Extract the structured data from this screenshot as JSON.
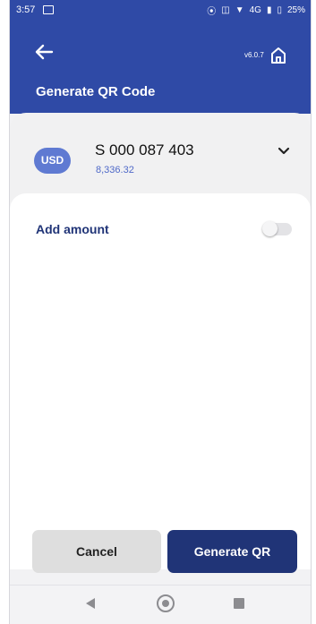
{
  "status_bar": {
    "time": "3:57",
    "network": "4G",
    "battery": "25%"
  },
  "app_bar": {
    "version": "v6.0.7",
    "title": "Generate QR Code"
  },
  "account": {
    "currency": "USD",
    "number": "S 000 087 403",
    "balance": "8,336.32"
  },
  "form": {
    "add_amount_label": "Add amount",
    "add_amount_enabled": false
  },
  "actions": {
    "cancel_label": "Cancel",
    "generate_label": "Generate QR"
  },
  "colors": {
    "primary": "#2f4aa6",
    "dark_primary": "#203477",
    "badge": "#5f7ad2",
    "balance_text": "#4f69c8"
  }
}
